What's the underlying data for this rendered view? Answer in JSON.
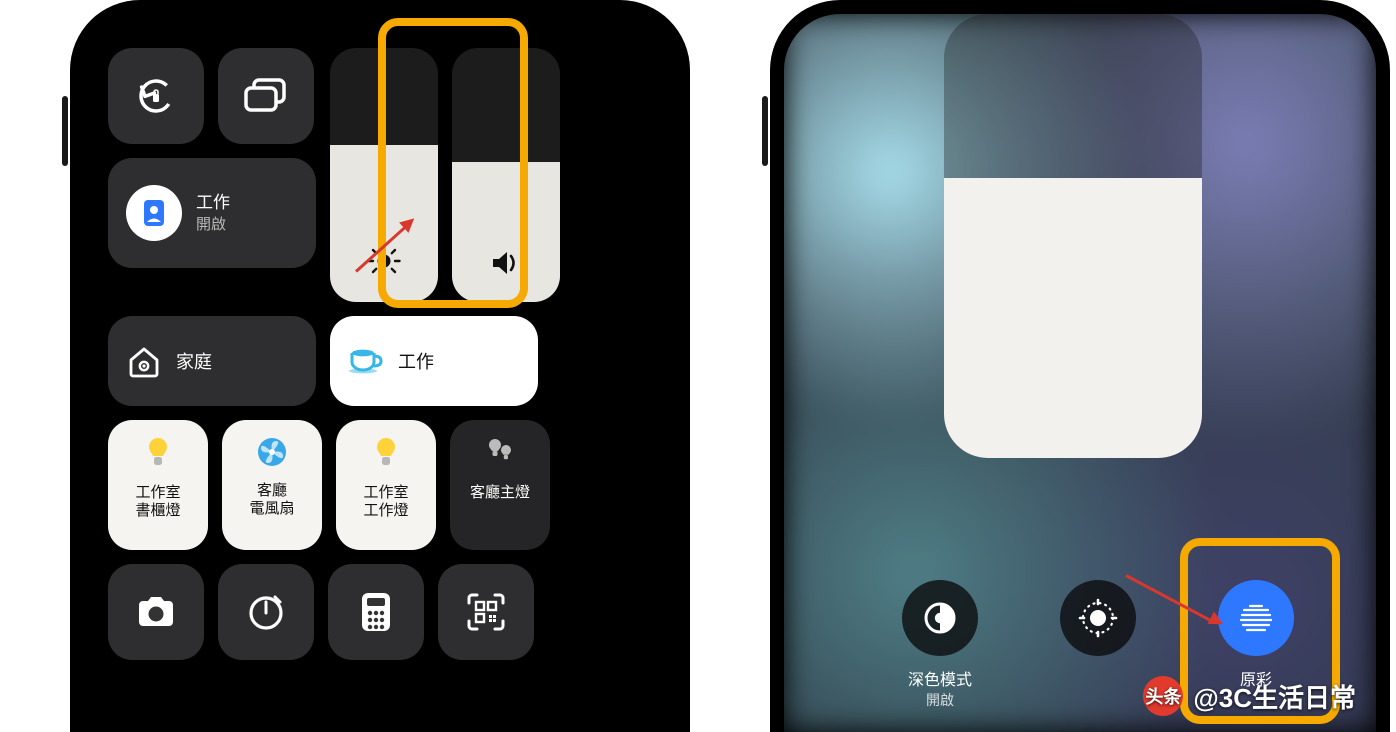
{
  "left": {
    "focus": {
      "title": "工作",
      "sub": "開啟"
    },
    "home_row": {
      "home": "家庭",
      "work": "工作"
    },
    "devices": [
      {
        "line1": "工作室",
        "line2": "書櫃燈"
      },
      {
        "line1": "客廳",
        "line2": "電風扇"
      },
      {
        "line1": "工作室",
        "line2": "工作燈"
      },
      {
        "single": "客廳主燈"
      }
    ],
    "sliders": {
      "brightness_pct": 62,
      "volume_pct": 55
    }
  },
  "right": {
    "dark_mode": {
      "label": "深色模式",
      "sub": "開啟"
    },
    "night_shift": {
      "label": ""
    },
    "true_tone": {
      "label": "原彩"
    },
    "brightness_pct": 63
  },
  "watermark": {
    "badge": "头条",
    "handle": "@3C生活日常"
  },
  "colors": {
    "highlight": "#f6a900",
    "arrow": "#d8382d",
    "blue": "#2e78ff"
  }
}
